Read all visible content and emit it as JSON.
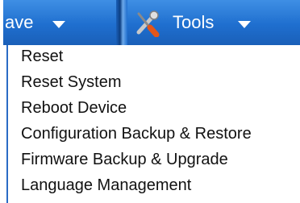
{
  "menubar": {
    "save_label": "ave",
    "tools_label": "Tools",
    "icons": {
      "dropdown": "caret-down-icon",
      "tools": "tools-icon"
    }
  },
  "tools_menu": {
    "items": [
      "Reset",
      "Reset System",
      "Reboot Device",
      "Configuration Backup & Restore",
      "Firmware Backup & Upgrade",
      "Language Management"
    ]
  },
  "colors": {
    "menubar": "#1f6fcf",
    "menu_text": "#111111",
    "menubar_text": "#ffffff"
  }
}
